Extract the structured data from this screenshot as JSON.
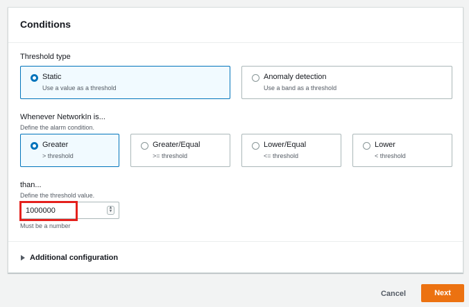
{
  "panel": {
    "title": "Conditions"
  },
  "threshold_type": {
    "label": "Threshold type",
    "options": [
      {
        "title": "Static",
        "subtitle": "Use a value as a threshold",
        "selected": true
      },
      {
        "title": "Anomaly detection",
        "subtitle": "Use a band as a threshold",
        "selected": false
      }
    ]
  },
  "condition": {
    "label": "Whenever NetworkIn is...",
    "description": "Define the alarm condition.",
    "options": [
      {
        "title": "Greater",
        "subtitle": "> threshold",
        "selected": true
      },
      {
        "title": "Greater/Equal",
        "subtitle": ">= threshold",
        "selected": false
      },
      {
        "title": "Lower/Equal",
        "subtitle": "<= threshold",
        "selected": false
      },
      {
        "title": "Lower",
        "subtitle": "< threshold",
        "selected": false
      }
    ]
  },
  "threshold_value": {
    "label": "than...",
    "description": "Define the threshold value.",
    "value": "1000000",
    "hint": "Must be a number"
  },
  "additional": {
    "label": "Additional configuration"
  },
  "footer": {
    "cancel_label": "Cancel",
    "next_label": "Next"
  },
  "colors": {
    "accent": "#0073bb",
    "primary_button": "#ec7211",
    "highlight": "#e4201c"
  }
}
